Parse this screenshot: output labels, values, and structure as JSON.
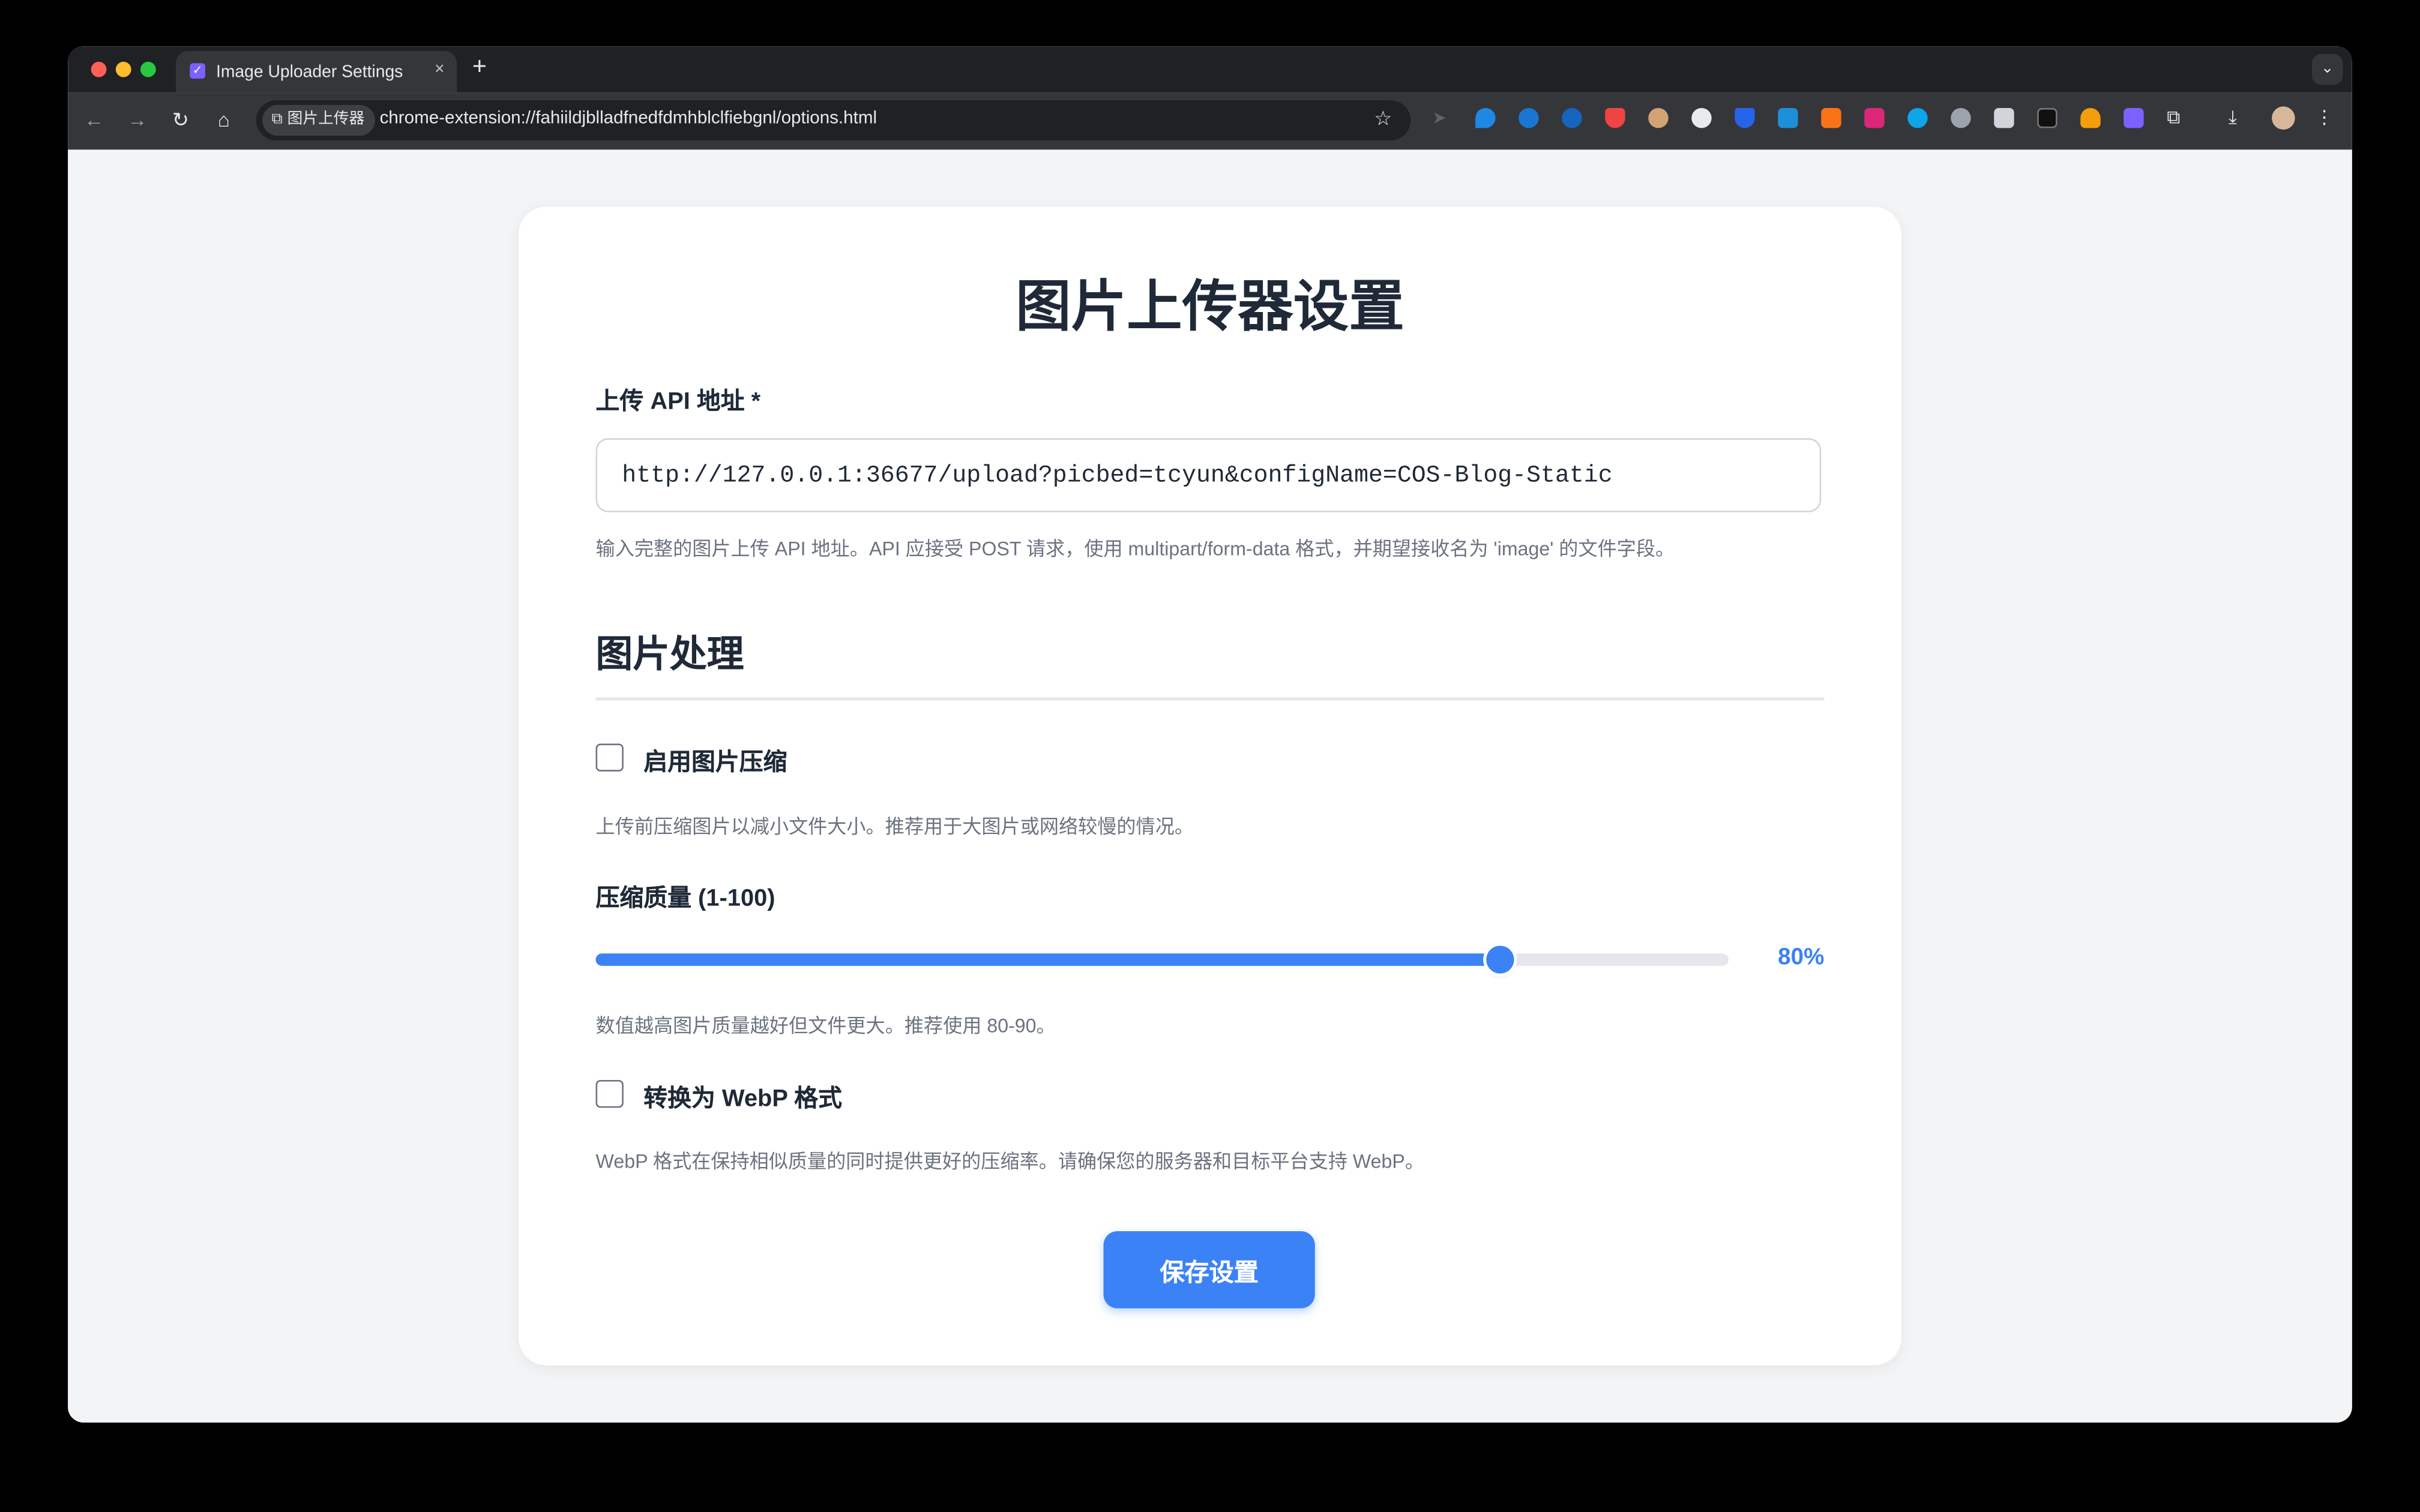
{
  "browser": {
    "tab_title": "Image Uploader Settings",
    "tab_close": "×",
    "new_tab": "+",
    "chip_label": "图片上传器",
    "url": "chrome-extension://fahiildjblladfnedfdmhblclfiebgnl/options.html"
  },
  "extensions": [
    "send-icon",
    "gem-icon",
    "sync-icon",
    "edge-icon",
    "pocket-icon",
    "owl-icon",
    "bot-icon",
    "shield-icon",
    "puzzle-blue-icon",
    "orange-icon",
    "translate-icon",
    "blue-circle-icon",
    "rss-icon",
    "reader-icon",
    "notion-icon",
    "fox-icon",
    "check-icon",
    "extensions-icon",
    "download-icon",
    "avatar-icon",
    "menu-icon"
  ],
  "colors": {
    "accent": "#3b82f6",
    "page_bg": "#f3f4f6",
    "text": "#1f2937",
    "muted": "#6b7280"
  },
  "page": {
    "title": "图片上传器设置",
    "api_label": "上传 API 地址 *",
    "api_value": "http://127.0.0.1:36677/upload?picbed=tcyun&configName=COS-Blog-Static",
    "api_help": "输入完整的图片上传 API 地址。API 应接受 POST 请求，使用 multipart/form-data 格式，并期望接收名为 'image' 的文件字段。",
    "section_title": "图片处理",
    "compress_label": "启用图片压缩",
    "compress_checked": false,
    "compress_help": "上传前压缩图片以减小文件大小。推荐用于大图片或网络较慢的情况。",
    "quality_label": "压缩质量 (1-100)",
    "quality_value": 80,
    "quality_display": "80%",
    "quality_help": "数值越高图片质量越好但文件更大。推荐使用 80-90。",
    "webp_label": "转换为 WebP 格式",
    "webp_checked": false,
    "webp_help": "WebP 格式在保持相似质量的同时提供更好的压缩率。请确保您的服务器和目标平台支持 WebP。",
    "save_label": "保存设置"
  }
}
